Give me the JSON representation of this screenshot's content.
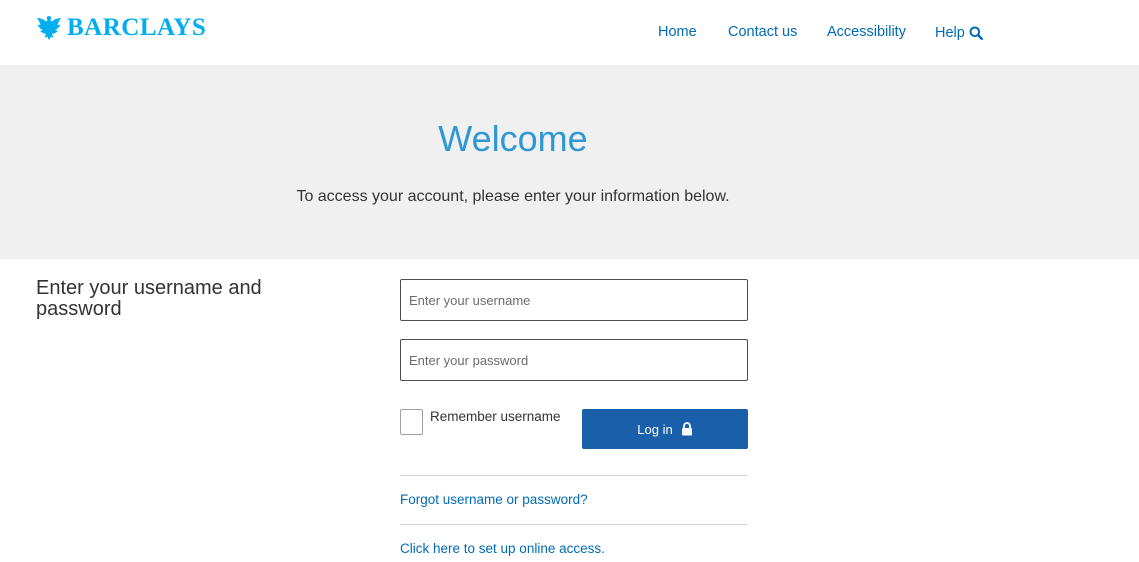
{
  "brand": {
    "logo_text": "BARCLAYS",
    "logo_icon": "eagle-icon",
    "color": "#00aeef"
  },
  "nav": {
    "items": [
      {
        "label": "Home"
      },
      {
        "label": "Contact us"
      },
      {
        "label": "Accessibility"
      },
      {
        "label": "Help",
        "icon": "search-icon"
      }
    ],
    "link_color": "#006ab7"
  },
  "hero": {
    "title": "Welcome",
    "subtitle": "To access your account, please enter your information below.",
    "background": "#f0f0f0",
    "title_color": "#2e97d6"
  },
  "login": {
    "section_title": "Enter your username and password",
    "username": {
      "value": "",
      "placeholder": "Enter your username"
    },
    "password": {
      "value": "",
      "placeholder": "Enter your password"
    },
    "remember_label": "Remember username",
    "remember_checked": false,
    "login_button_label": "Log in",
    "login_button_icon": "lock-icon",
    "button_color": "#1a5fa9",
    "forgot_link": "Forgot username or password?",
    "setup_link": "Click here to set up online access."
  }
}
